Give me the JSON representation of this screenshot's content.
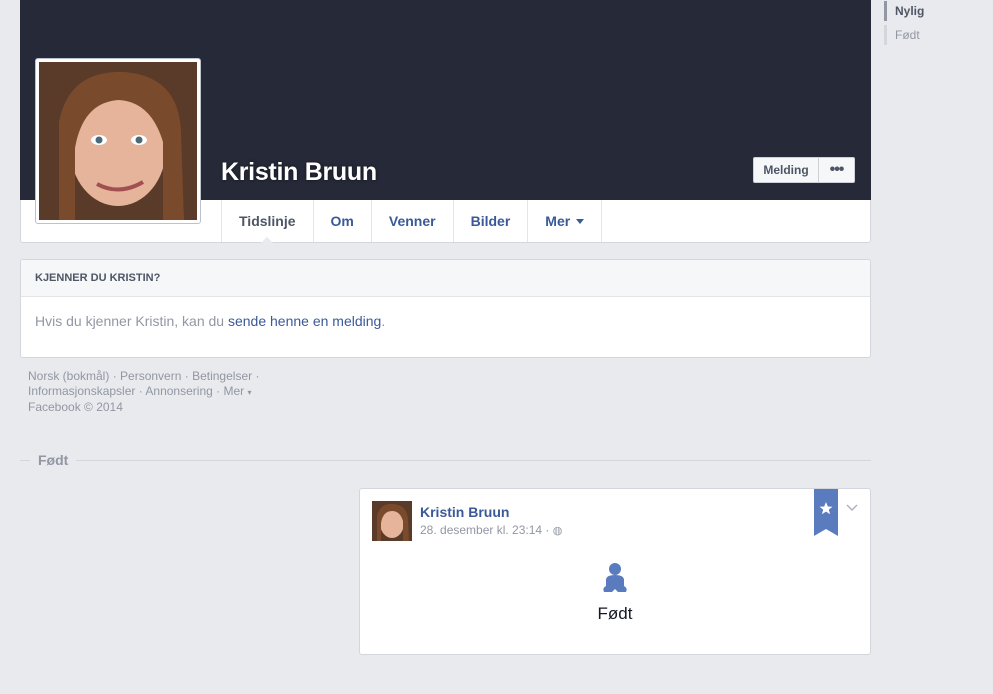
{
  "profile": {
    "name": "Kristin Bruun",
    "message_button": "Melding",
    "more_button": "•••"
  },
  "tabs": [
    {
      "label": "Tidslinje"
    },
    {
      "label": "Om"
    },
    {
      "label": "Venner"
    },
    {
      "label": "Bilder"
    },
    {
      "label": "Mer"
    }
  ],
  "know_box": {
    "title": "KJENNER DU KRISTIN?",
    "text_before": "Hvis du kjenner Kristin, kan du ",
    "link": "sende henne en melding",
    "text_after": "."
  },
  "footer": {
    "links": [
      "Norsk (bokmål)",
      "Personvern",
      "Betingelser",
      "Informasjonskapsler",
      "Annonsering",
      "Mer"
    ],
    "copyright": "Facebook © 2014"
  },
  "section": {
    "label": "Født"
  },
  "post": {
    "author": "Kristin Bruun",
    "timestamp": "28. desember kl. 23:14 ·",
    "event": "Født"
  },
  "right_nav": [
    {
      "label": "Nylig"
    },
    {
      "label": "Født"
    }
  ],
  "colors": {
    "cover": "#262a38",
    "link": "#3b5998",
    "background": "#e9eaed",
    "ribbon": "#5b7bbf"
  },
  "icons": [
    "world-icon",
    "baby-icon",
    "star-ribbon-icon",
    "chevron-down-icon",
    "caret-down-icon"
  ]
}
